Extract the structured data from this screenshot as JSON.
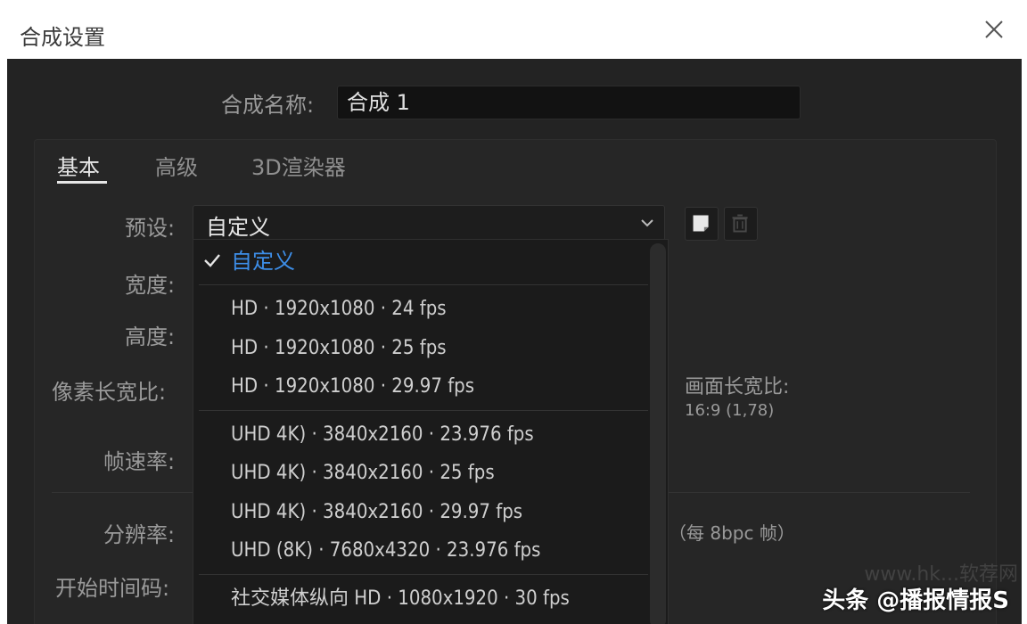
{
  "window": {
    "title": "合成设置"
  },
  "composition_name": {
    "label": "合成名称:",
    "value": "合成 1"
  },
  "tabs": [
    {
      "label": "基本",
      "active": true
    },
    {
      "label": "高级",
      "active": false
    },
    {
      "label": "3D渲染器",
      "active": false
    }
  ],
  "fields": {
    "preset": "预设:",
    "width": "宽度:",
    "height": "高度:",
    "pixel_aspect": "像素长宽比:",
    "frame_rate": "帧速率:",
    "resolution": "分辨率:",
    "start_timecode": "开始时间码:"
  },
  "preset": {
    "selected": "自定义",
    "options": [
      {
        "label": "自定义",
        "selected": true
      },
      {
        "label": "HD  ·  1920x1080 · 24 fps"
      },
      {
        "label": "HD  ·  1920x1080 · 25 fps"
      },
      {
        "label": "HD  ·  1920x1080 · 29.97 fps"
      },
      {
        "label": "UHD 4K)  ·  3840x2160 · 23.976 fps"
      },
      {
        "label": "UHD 4K)  ·  3840x2160 · 25 fps"
      },
      {
        "label": "UHD 4K)  ·  3840x2160 · 29.97 fps"
      },
      {
        "label": "UHD (8K)  ·  7680x4320 · 23.976 fps"
      },
      {
        "label": "社交媒体纵向 HD  ·  1080x1920 · 30 fps"
      }
    ]
  },
  "frame_aspect": {
    "label": "画面长宽比:",
    "value": "16:9 (1,78)"
  },
  "resolution_info": "（每 8bpc 帧）",
  "watermark": {
    "main": "头条 @播报情报S",
    "faint": "www.hk...软荐网"
  },
  "colors": {
    "accent": "#3d8ee8",
    "panel": "#232323",
    "input": "#121212"
  },
  "icons": {
    "close": "close-icon",
    "save_preset": "save-preset-icon",
    "delete_preset": "trash-icon",
    "dropdown": "chevron-down-icon",
    "selected": "checkmark-icon"
  }
}
